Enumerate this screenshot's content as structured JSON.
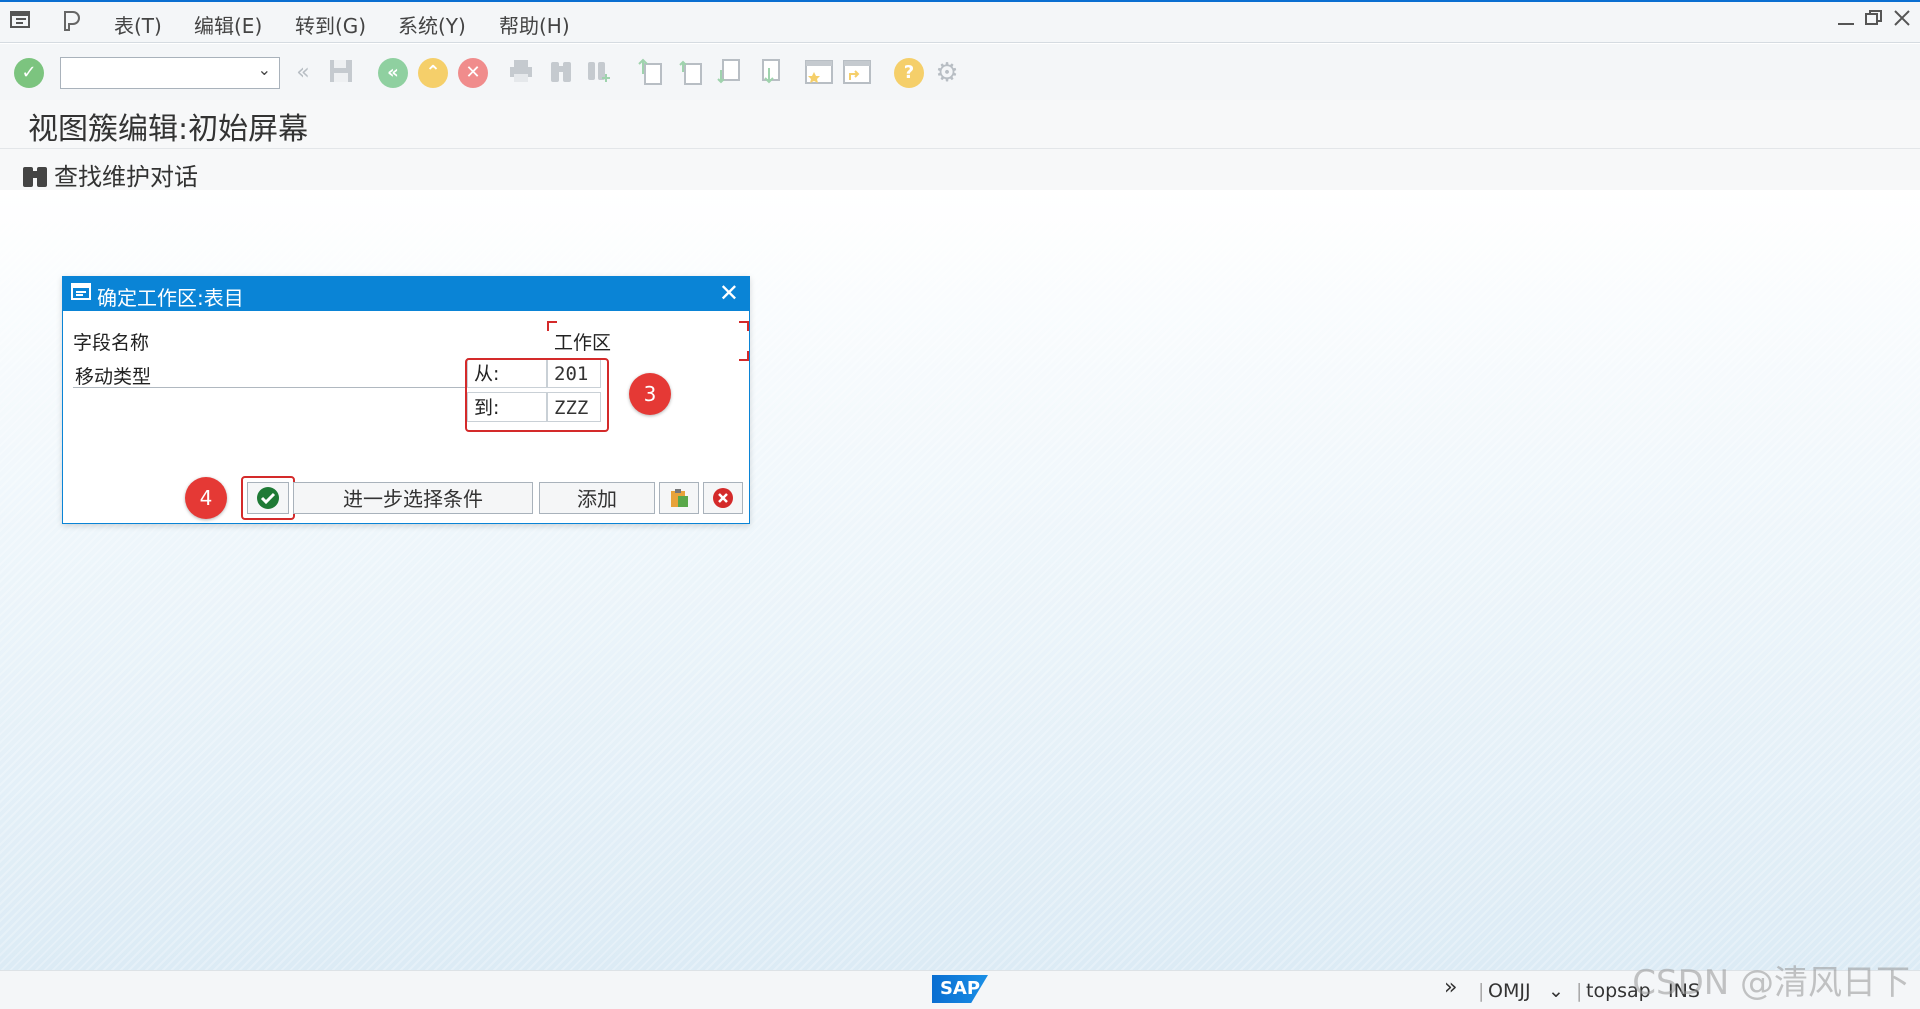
{
  "menu": {
    "items": [
      "表(T)",
      "编辑(E)",
      "转到(G)",
      "系统(Y)",
      "帮助(H)"
    ]
  },
  "toolbar": {
    "command_value": "",
    "icons": [
      "enter-icon",
      "back-icon",
      "save-icon",
      "back-green-icon",
      "exit-icon",
      "cancel-icon",
      "print-icon",
      "find-icon",
      "find-next-icon",
      "first-page-icon",
      "prev-page-icon",
      "next-page-icon",
      "last-page-icon",
      "new-session-icon",
      "shortcut-icon",
      "help-icon",
      "settings-icon"
    ]
  },
  "screen": {
    "title": "视图簇编辑:初始屏幕",
    "find_action": "查找维护对话"
  },
  "dialog": {
    "title": "确定工作区:表目",
    "field_header": "字段名称",
    "workarea_header": "工作区",
    "field_name": "移动类型",
    "from_label": "从:",
    "from_value": "201",
    "to_label": "到:",
    "to_value": "ZZZ",
    "more_button": "进一步选择条件",
    "add_button": "添加",
    "marker_3": "3",
    "marker_4": "4"
  },
  "statusbar": {
    "logo": "SAP",
    "transaction": "OMJJ",
    "server": "topsap",
    "mode": "INS"
  },
  "watermark": "CSDN @清风日下",
  "colors": {
    "accent": "#0a84d6",
    "highlight_red": "#d42a2a",
    "marker_red": "#e53935",
    "confirm_green": "#2e9e44"
  }
}
